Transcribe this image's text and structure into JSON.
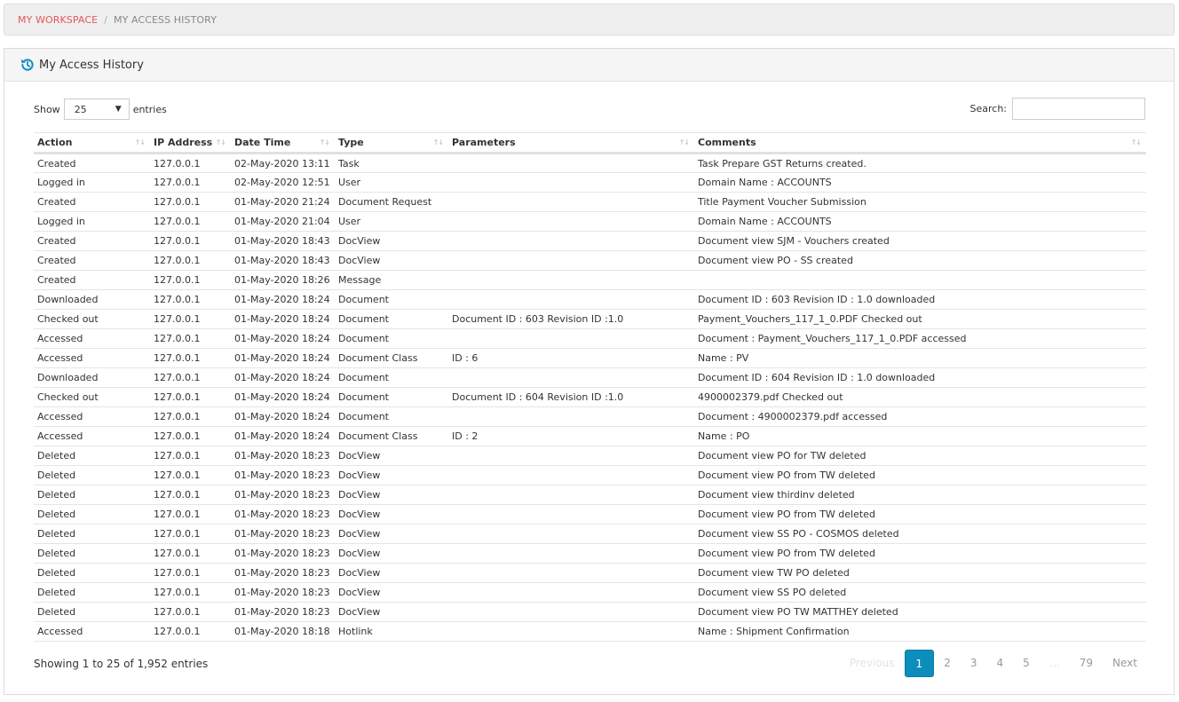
{
  "breadcrumb": {
    "root": "MY WORKSPACE",
    "separator": "/",
    "current": "MY ACCESS HISTORY"
  },
  "panel": {
    "title": "My Access History",
    "icon": "history-icon"
  },
  "controls": {
    "show_label": "Show",
    "entries_label": "entries",
    "page_length": "25",
    "search_label": "Search:",
    "search_value": ""
  },
  "table": {
    "columns": [
      "Action",
      "IP Address",
      "Date Time",
      "Type",
      "Parameters",
      "Comments"
    ],
    "rows": [
      {
        "action": "Created",
        "ip": "127.0.0.1",
        "datetime": "02-May-2020 13:11",
        "type": "Task",
        "params": "",
        "comments": "Task Prepare GST Returns created."
      },
      {
        "action": "Logged in",
        "ip": "127.0.0.1",
        "datetime": "02-May-2020 12:51",
        "type": "User",
        "params": "",
        "comments": "Domain Name : ACCOUNTS"
      },
      {
        "action": "Created",
        "ip": "127.0.0.1",
        "datetime": "01-May-2020 21:24",
        "type": "Document Request",
        "params": "",
        "comments": "Title Payment Voucher Submission"
      },
      {
        "action": "Logged in",
        "ip": "127.0.0.1",
        "datetime": "01-May-2020 21:04",
        "type": "User",
        "params": "",
        "comments": "Domain Name : ACCOUNTS"
      },
      {
        "action": "Created",
        "ip": "127.0.0.1",
        "datetime": "01-May-2020 18:43",
        "type": "DocView",
        "params": "",
        "comments": "Document view SJM - Vouchers created"
      },
      {
        "action": "Created",
        "ip": "127.0.0.1",
        "datetime": "01-May-2020 18:43",
        "type": "DocView",
        "params": "",
        "comments": "Document view PO - SS created"
      },
      {
        "action": "Created",
        "ip": "127.0.0.1",
        "datetime": "01-May-2020 18:26",
        "type": "Message",
        "params": "",
        "comments": ""
      },
      {
        "action": "Downloaded",
        "ip": "127.0.0.1",
        "datetime": "01-May-2020 18:24",
        "type": "Document",
        "params": "",
        "comments": "Document ID : 603 Revision ID : 1.0 downloaded"
      },
      {
        "action": "Checked out",
        "ip": "127.0.0.1",
        "datetime": "01-May-2020 18:24",
        "type": "Document",
        "params": "Document ID : 603 Revision ID :1.0",
        "comments": "Payment_Vouchers_117_1_0.PDF Checked out"
      },
      {
        "action": "Accessed",
        "ip": "127.0.0.1",
        "datetime": "01-May-2020 18:24",
        "type": "Document",
        "params": "",
        "comments": "Document : Payment_Vouchers_117_1_0.PDF accessed"
      },
      {
        "action": "Accessed",
        "ip": "127.0.0.1",
        "datetime": "01-May-2020 18:24",
        "type": "Document Class",
        "params": "ID : 6",
        "comments": "Name : PV"
      },
      {
        "action": "Downloaded",
        "ip": "127.0.0.1",
        "datetime": "01-May-2020 18:24",
        "type": "Document",
        "params": "",
        "comments": "Document ID : 604 Revision ID : 1.0 downloaded"
      },
      {
        "action": "Checked out",
        "ip": "127.0.0.1",
        "datetime": "01-May-2020 18:24",
        "type": "Document",
        "params": "Document ID : 604 Revision ID :1.0",
        "comments": "4900002379.pdf Checked out"
      },
      {
        "action": "Accessed",
        "ip": "127.0.0.1",
        "datetime": "01-May-2020 18:24",
        "type": "Document",
        "params": "",
        "comments": "Document : 4900002379.pdf accessed"
      },
      {
        "action": "Accessed",
        "ip": "127.0.0.1",
        "datetime": "01-May-2020 18:24",
        "type": "Document Class",
        "params": "ID : 2",
        "comments": "Name : PO"
      },
      {
        "action": "Deleted",
        "ip": "127.0.0.1",
        "datetime": "01-May-2020 18:23",
        "type": "DocView",
        "params": "",
        "comments": "Document view PO for TW deleted"
      },
      {
        "action": "Deleted",
        "ip": "127.0.0.1",
        "datetime": "01-May-2020 18:23",
        "type": "DocView",
        "params": "",
        "comments": "Document view PO from TW deleted"
      },
      {
        "action": "Deleted",
        "ip": "127.0.0.1",
        "datetime": "01-May-2020 18:23",
        "type": "DocView",
        "params": "",
        "comments": "Document view thirdinv deleted"
      },
      {
        "action": "Deleted",
        "ip": "127.0.0.1",
        "datetime": "01-May-2020 18:23",
        "type": "DocView",
        "params": "",
        "comments": "Document view PO from TW deleted"
      },
      {
        "action": "Deleted",
        "ip": "127.0.0.1",
        "datetime": "01-May-2020 18:23",
        "type": "DocView",
        "params": "",
        "comments": "Document view SS PO - COSMOS deleted"
      },
      {
        "action": "Deleted",
        "ip": "127.0.0.1",
        "datetime": "01-May-2020 18:23",
        "type": "DocView",
        "params": "",
        "comments": "Document view PO from TW deleted"
      },
      {
        "action": "Deleted",
        "ip": "127.0.0.1",
        "datetime": "01-May-2020 18:23",
        "type": "DocView",
        "params": "",
        "comments": "Document view TW PO deleted"
      },
      {
        "action": "Deleted",
        "ip": "127.0.0.1",
        "datetime": "01-May-2020 18:23",
        "type": "DocView",
        "params": "",
        "comments": "Document view SS PO deleted"
      },
      {
        "action": "Deleted",
        "ip": "127.0.0.1",
        "datetime": "01-May-2020 18:23",
        "type": "DocView",
        "params": "",
        "comments": "Document view PO TW MATTHEY deleted"
      },
      {
        "action": "Accessed",
        "ip": "127.0.0.1",
        "datetime": "01-May-2020 18:18",
        "type": "Hotlink",
        "params": "",
        "comments": "Name : Shipment Confirmation"
      }
    ]
  },
  "footer": {
    "info": "Showing 1 to 25 of 1,952 entries",
    "pagination": {
      "previous": "Previous",
      "pages": [
        "1",
        "2",
        "3",
        "4",
        "5"
      ],
      "ellipsis": "…",
      "last": "79",
      "next": "Next",
      "current": "1"
    }
  },
  "colors": {
    "breadcrumb_link": "#e45757",
    "accent": "#0c8ebd"
  }
}
